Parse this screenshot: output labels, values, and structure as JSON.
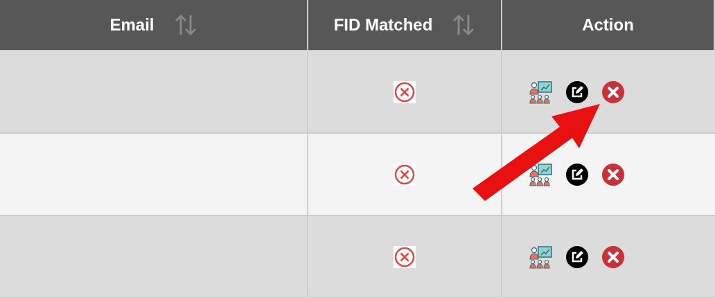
{
  "table": {
    "columns": [
      {
        "label": "Email",
        "sortable": true
      },
      {
        "label": "FID Matched",
        "sortable": true
      },
      {
        "label": "Action",
        "sortable": false
      }
    ],
    "rows": [
      {
        "fid_matched": false
      },
      {
        "fid_matched": false
      },
      {
        "fid_matched": false
      }
    ]
  },
  "annotation": {
    "kind": "arrow"
  }
}
